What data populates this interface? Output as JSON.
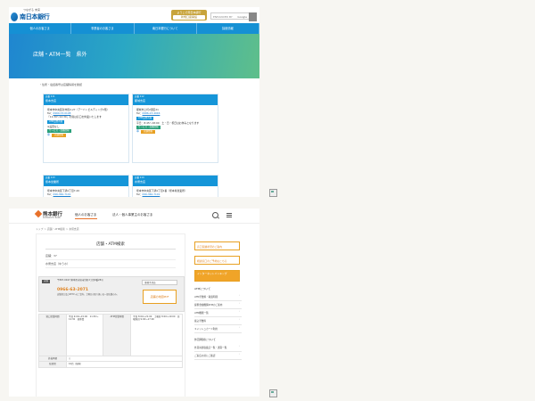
{
  "shot1": {
    "logo_tagline": "つながる 未来",
    "logo_text": "南日本銀行",
    "promo": {
      "line1": "ようこそ南日本銀行",
      "line2": "新規口座開設"
    },
    "search": {
      "placeholder": "ENHANCED BY",
      "brand": "Google"
    },
    "nav": [
      "個人のお客さま",
      "事業者のお客さま",
      "南日本銀行について",
      "採用情報"
    ],
    "hero_title": "店舗・ATM一覧　県外",
    "note": "・住所・電話番号は店舗情報を確認",
    "cards": [
      {
        "code": "店番 111",
        "name": "熊本支店",
        "address": "熊本市中央区新市街2-27（アーバンビルディング2階）",
        "tel_label": "Tel：",
        "tel": "0969-33-0108",
        "hours": "「11:30～12:30」の間は窓口を休業いたします",
        "tag1": "ATM設置有無",
        "atm": "※設置なし",
        "tag2": "サービス・設備情報",
        "icon_label": "車",
        "tag3": "店舗情報"
      },
      {
        "code": "店番 112",
        "name": "都城支店",
        "address": "都城市上町2街区21",
        "tel_label": "Tel：",
        "tel": "0986-23-4046",
        "hours": "",
        "tag1": "ATM設置有無",
        "atm": "平日：8:45～18:00　土・日・祝日はお休みとなります",
        "tag2": "サービス・設備情報",
        "icon_label": "車",
        "tag3": "店舗情報"
      },
      {
        "code": "店番 113",
        "name": "熊本営業所",
        "address": "熊本市中央区下通1丁目7-20",
        "tel_label": "Tel：",
        "tel": "096-360-7101"
      },
      {
        "code": "店番 114",
        "name": "水俣支店",
        "address": "熊本市中央区下通1丁目1番（熊本県営業所）",
        "tel_label": "Tel：",
        "tel": "096-360-7101"
      }
    ]
  },
  "shot2": {
    "logo_text": "熊本銀行",
    "logo_sub": "KUMAMOTO BANK",
    "tabs": [
      "個人のお客さま",
      "法人・個人事業主のお客さま"
    ],
    "breadcrumb": "トップ ＞ 店舗・ATM検索 ＞ 水俣支店",
    "page_title": "店舗・ATM検索",
    "filter_rows": [
      "店舗：37",
      "水俣支店（ゆうホ）"
    ],
    "card": {
      "badge": "水俣",
      "address": "〒867-0047 熊本県水俣市浜町2丁目9番28号",
      "tel": "0966-63-2071",
      "hint": "店舗窓口及びATMへのご案内。土曜日の取り扱いは一部店舗のみ。",
      "tag": "車椅子対応",
      "pdf_button": "店舗の地図PDF"
    },
    "table": [
      {
        "h1": "窓口営業時間",
        "v1": "平日 9:00～15:00　11:30～12:30　昼休業",
        "h2": "ATM営業時間",
        "v2": "平日 8:00～21:00　土曜日 8:00～19:00　日曜祝日 9:00～17:00"
      },
      {
        "h1": "外貨両替",
        "v1": "○",
        "h2": "",
        "v2": ""
      },
      {
        "h1": "駐車場",
        "v1": "10台（無料）",
        "h2": "",
        "v2": ""
      }
    ],
    "side": {
      "btn1": "窓口混雑状況のご案内",
      "btn2": "相談窓口のご予約はこちら",
      "btn3": "インターネットバンキング",
      "head1": "ATMについて",
      "list1": [
        "ATM手数料・取扱時間",
        "提携金融機関ATMのご案内",
        "ATM機能一覧",
        "振込手数料",
        "キャッシュカード利用"
      ],
      "head2": "外貨両替について",
      "list2": [
        "外貨両替取扱店一覧・通貨一覧",
        "ご来店の前にご確認"
      ]
    }
  }
}
